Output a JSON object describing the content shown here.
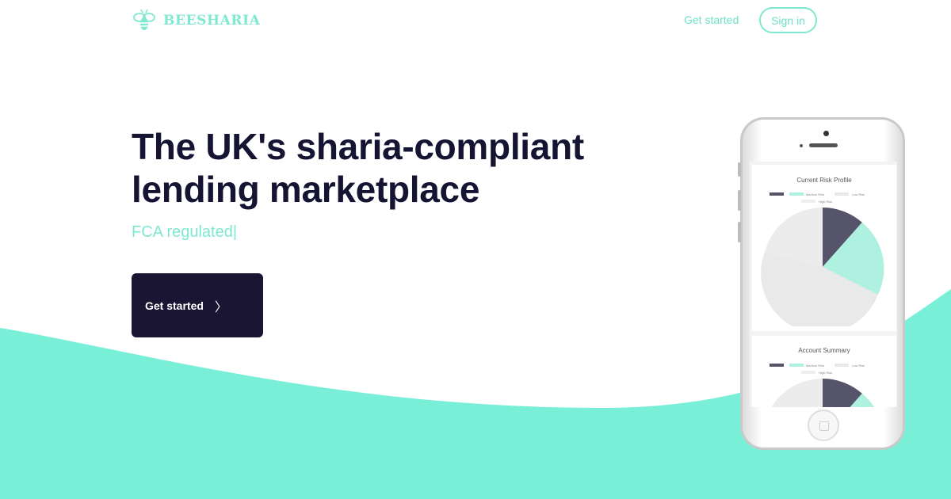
{
  "brand": {
    "name": "BEESHARIA",
    "color": "#7ee9d0",
    "icon": "bee-icon"
  },
  "nav": {
    "get_started": "Get started",
    "sign_in": "Sign in"
  },
  "hero": {
    "title_line1": "The UK's sharia-compliant",
    "title_line2": "lending marketplace",
    "subtitle": "FCA regulated",
    "cursor": "|",
    "cta_label": "Get started",
    "cta_icon": "chevron-right-icon",
    "cta_chevron": "〉"
  },
  "colors": {
    "dark": "#1a1533",
    "accent": "#7ee9d0",
    "wave": "#7aefd8"
  },
  "phone": {
    "card1": {
      "title": "Current Risk Profile",
      "legend": {
        "medium": "Medium Risk",
        "low": "Low Risk",
        "high": "High Risk"
      }
    },
    "card2": {
      "title": "Account Summary",
      "legend": {
        "medium": "Medium Risk",
        "low": "Low Risk",
        "high": "High Risk"
      }
    }
  }
}
